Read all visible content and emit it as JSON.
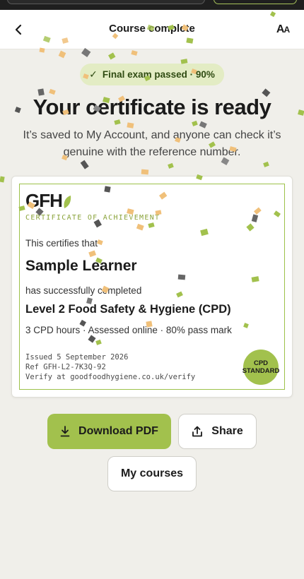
{
  "header": {
    "title": "Course complete",
    "back_icon": "chevron-left-icon",
    "text_size_icon": "text-size-icon"
  },
  "badge": {
    "label": "Final exam passed · 90%",
    "icon": "check-icon"
  },
  "headline": "Your certificate is ready",
  "subtext": "It’s saved to My Account, and anyone can check it’s genuine with the reference number.",
  "certificate": {
    "logo": "GFH",
    "kicker": "CERTIFICATE OF ACHIEVEMENT",
    "certifies": "This certifies that",
    "learner": "Sample Learner",
    "completed": "has successfully completed",
    "course": "Level 2 Food Safety & Hygiene (CPD)",
    "details": "3 CPD hours · Assessed online · 80% pass mark",
    "issued": "Issued 5 September 2026",
    "ref": "Ref GFH-L2-7K3Q-92",
    "verify": "Verify at goodfoodhygiene.co.uk/verify",
    "seal_line1": "CPD",
    "seal_line2": "STANDARD"
  },
  "actions": {
    "download": "Download PDF",
    "share": "Share",
    "my_courses": "My courses"
  },
  "colors": {
    "accent": "#a2c14d",
    "badge_bg": "#e3ecc4",
    "page_bg": "#f0efea"
  }
}
